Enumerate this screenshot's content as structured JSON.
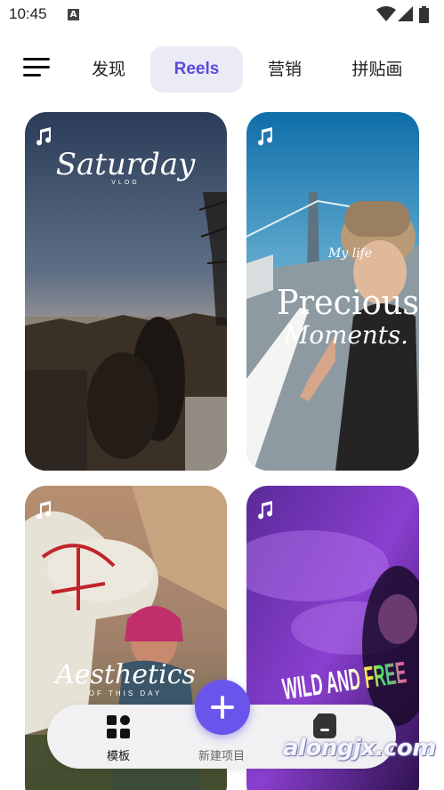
{
  "status_bar": {
    "time": "10:45",
    "notification_letter": "A",
    "icons": [
      "wifi-icon",
      "signal-icon",
      "battery-icon"
    ]
  },
  "tabs": {
    "items": [
      {
        "label": "发现",
        "active": false
      },
      {
        "label": "Reels",
        "active": true
      },
      {
        "label": "营销",
        "active": false
      },
      {
        "label": "拼贴画",
        "active": false
      }
    ]
  },
  "templates": [
    {
      "title": "Saturday",
      "subtitle": "VLOG",
      "has_music": true
    },
    {
      "title": "Precious",
      "title2": "Moments.",
      "tag": "My life",
      "has_music": true
    },
    {
      "title": "Aesthetics",
      "subtitle": "OF THIS DAY",
      "has_music": true
    },
    {
      "title": "WILD AND FREE",
      "has_music": true
    }
  ],
  "bottom_nav": {
    "templates_label": "模板",
    "new_project_label": "新建项目",
    "drafts_label": ""
  },
  "watermark": "alongjx.com",
  "colors": {
    "accent": "#5b4bdb",
    "fab": "#6a55ec",
    "tab_active_bg": "#ebebf5"
  }
}
